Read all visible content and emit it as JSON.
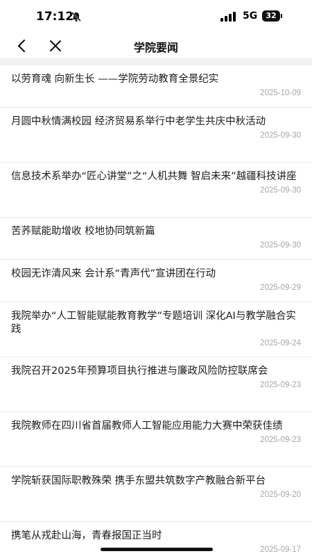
{
  "status_bar": {
    "time": "17:12",
    "network": "5G",
    "battery": "32"
  },
  "header": {
    "title": "学院要闻"
  },
  "news": [
    {
      "title": "以劳育魂 向新生长 ——学院劳动教育全景纪实",
      "date": "2025-10-09"
    },
    {
      "title": "月圆中秋情满校园 经济贸易系举行中老学生共庆中秋活动",
      "date": "2025-09-30"
    },
    {
      "title": "信息技术系举办“匠心讲堂”之“人机共舞 智启未来”越疆科技讲座",
      "date": "2025-09-30"
    },
    {
      "title": "苦荞赋能助增收 校地协同筑新篇",
      "date": "2025-09-30"
    },
    {
      "title": "校园无诈清风来 会计系“青声代”宣讲团在行动",
      "date": "2025-09-29"
    },
    {
      "title": "我院举办“人工智能赋能教育教学”专题培训 深化AI与教学融合实践",
      "date": "2025-09-24"
    },
    {
      "title": "我院召开2025年预算项目执行推进与廉政风险防控联席会",
      "date": "2025-09-23"
    },
    {
      "title": "我院教师在四川省首届教师人工智能应用能力大赛中荣获佳绩",
      "date": "2025-09-23"
    },
    {
      "title": "学院斩获国际职教殊荣 携手东盟共筑数字产教融合新平台",
      "date": "2025-09-20"
    },
    {
      "title": "携笔从戎赴山海，青春报国正当时",
      "date": "2025-09-17"
    }
  ]
}
